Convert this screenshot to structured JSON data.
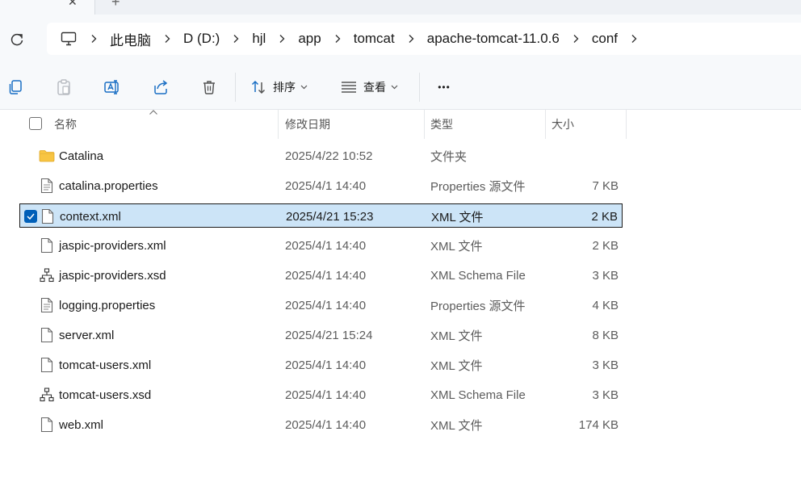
{
  "window": {
    "new_tab_glyph": "+"
  },
  "breadcrumb": {
    "items": [
      "此电脑",
      "D (D:)",
      "hjl",
      "app",
      "tomcat",
      "apache-tomcat-11.0.6",
      "conf"
    ]
  },
  "toolbar": {
    "sort_label": "排序",
    "view_label": "查看",
    "more_label": "•••"
  },
  "columns": {
    "name": "名称",
    "modified": "修改日期",
    "type": "类型",
    "size": "大小"
  },
  "files": [
    {
      "name": "Catalina",
      "modified": "2025/4/22 10:52",
      "type": "文件夹",
      "size": "",
      "icon": "folder-icon",
      "selected": false
    },
    {
      "name": "catalina.properties",
      "modified": "2025/4/1 14:40",
      "type": "Properties 源文件",
      "size": "7 KB",
      "icon": "text-file-icon",
      "selected": false
    },
    {
      "name": "context.xml",
      "modified": "2025/4/21 15:23",
      "type": "XML 文件",
      "size": "2 KB",
      "icon": "file-icon",
      "selected": true
    },
    {
      "name": "jaspic-providers.xml",
      "modified": "2025/4/1 14:40",
      "type": "XML 文件",
      "size": "2 KB",
      "icon": "file-icon",
      "selected": false
    },
    {
      "name": "jaspic-providers.xsd",
      "modified": "2025/4/1 14:40",
      "type": "XML Schema File",
      "size": "3 KB",
      "icon": "schema-icon",
      "selected": false
    },
    {
      "name": "logging.properties",
      "modified": "2025/4/1 14:40",
      "type": "Properties 源文件",
      "size": "4 KB",
      "icon": "text-file-icon",
      "selected": false
    },
    {
      "name": "server.xml",
      "modified": "2025/4/21 15:24",
      "type": "XML 文件",
      "size": "8 KB",
      "icon": "file-icon",
      "selected": false
    },
    {
      "name": "tomcat-users.xml",
      "modified": "2025/4/1 14:40",
      "type": "XML 文件",
      "size": "3 KB",
      "icon": "file-icon",
      "selected": false
    },
    {
      "name": "tomcat-users.xsd",
      "modified": "2025/4/1 14:40",
      "type": "XML Schema File",
      "size": "3 KB",
      "icon": "schema-icon",
      "selected": false
    },
    {
      "name": "web.xml",
      "modified": "2025/4/1 14:40",
      "type": "XML 文件",
      "size": "174 KB",
      "icon": "file-icon",
      "selected": false
    }
  ],
  "colors": {
    "accent": "#005fb8",
    "selection": "#cce4f7",
    "folder": "#f8c543"
  }
}
